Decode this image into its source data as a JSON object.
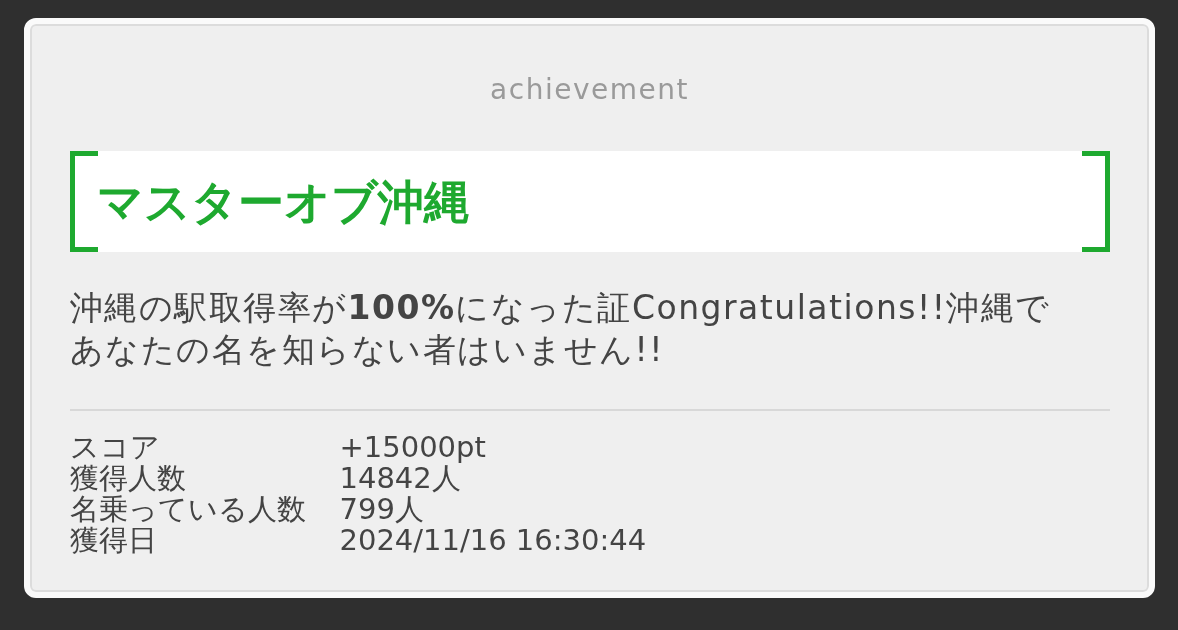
{
  "dialog": {
    "heading": "achievement",
    "title": "マスターオブ沖縄",
    "description": "沖縄の駅取得率が**100%**になった証Congratulations!!沖縄であなたの名を知らない者はいません!!",
    "stats": [
      {
        "label": "スコア",
        "value": "+15000pt"
      },
      {
        "label": "獲得人数",
        "value": "14842人"
      },
      {
        "label": "名乗っている人数",
        "value": "799人"
      },
      {
        "label": "獲得日",
        "value": "2024/11/16 16:30:44"
      }
    ]
  }
}
